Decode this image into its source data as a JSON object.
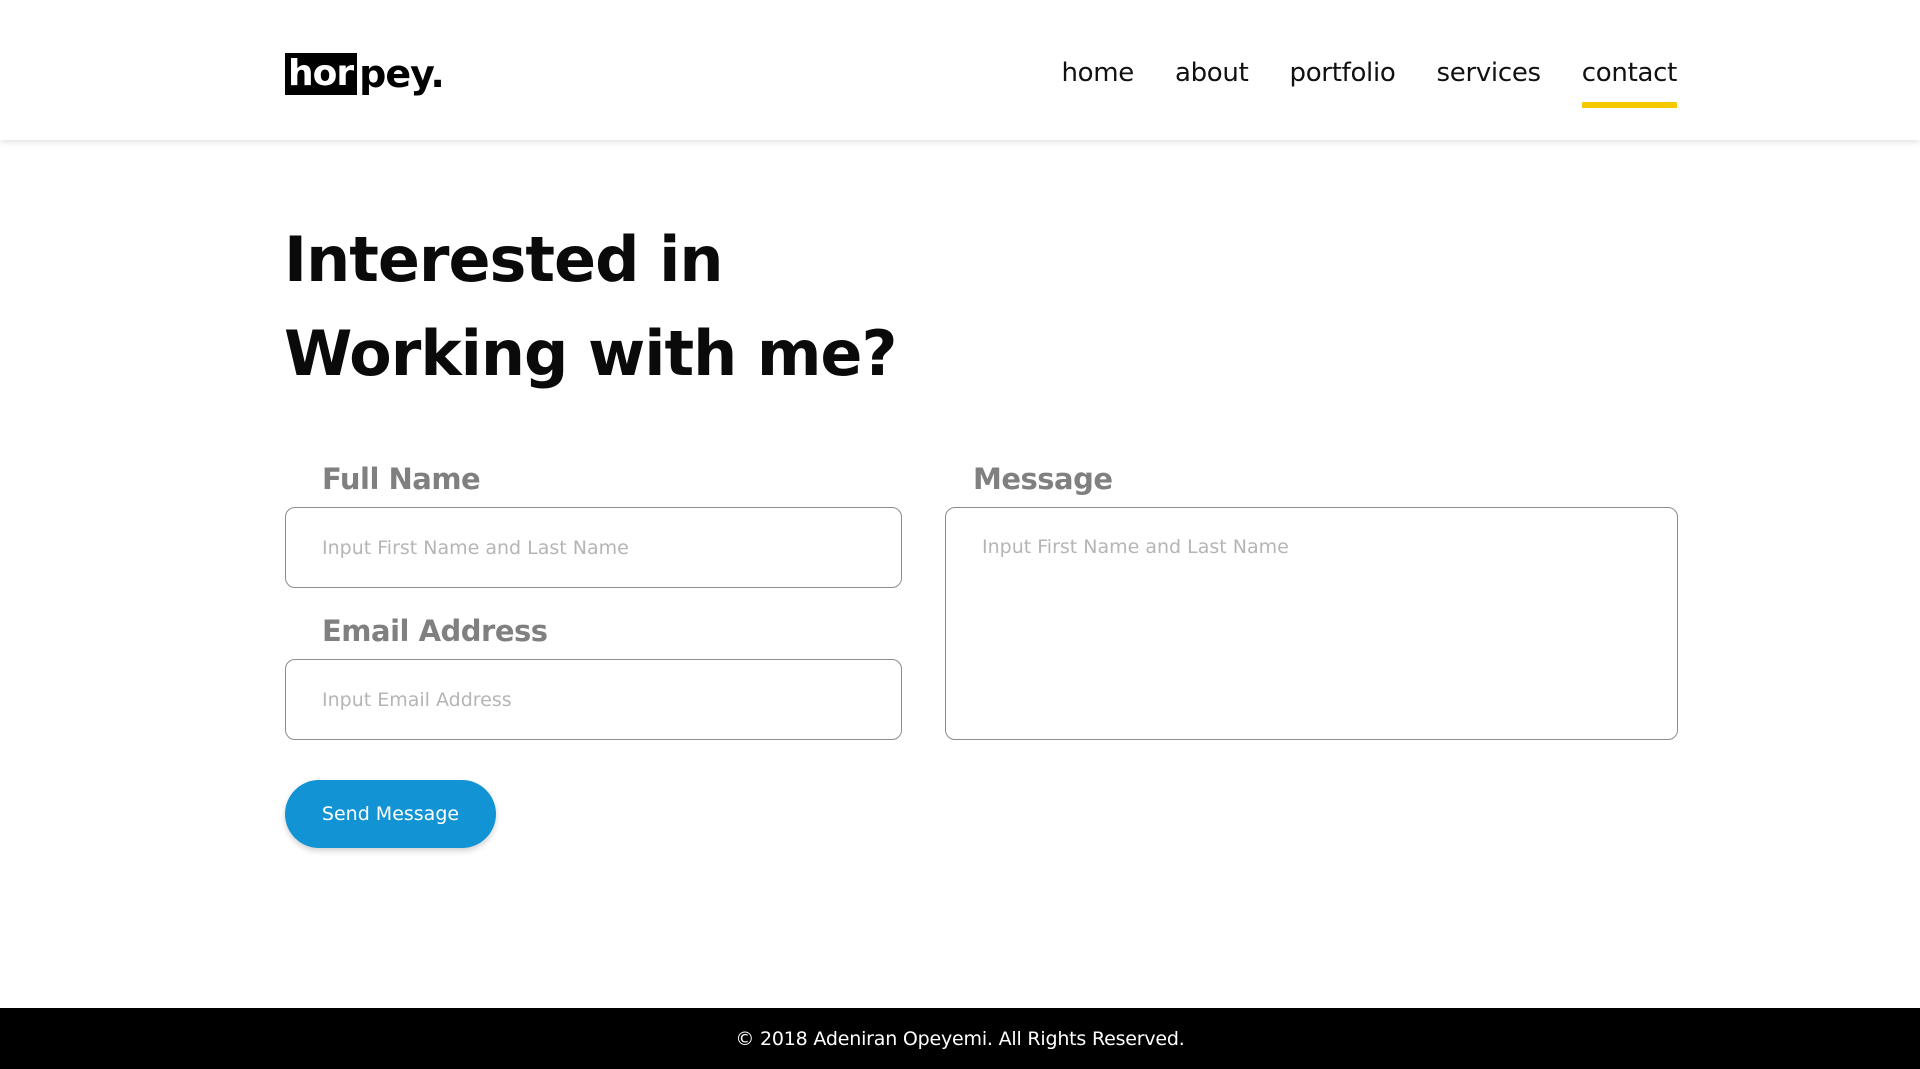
{
  "brand": {
    "logo_highlight": "hor",
    "logo_rest": "pey."
  },
  "nav": {
    "items": [
      {
        "label": "home",
        "active": false
      },
      {
        "label": "about",
        "active": false
      },
      {
        "label": "portfolio",
        "active": false
      },
      {
        "label": "services",
        "active": false
      },
      {
        "label": "contact",
        "active": true
      }
    ]
  },
  "hero": {
    "line1": "Interested in",
    "line2": "Working with me?"
  },
  "form": {
    "full_name_label": "Full Name",
    "full_name_placeholder": "Input First Name and Last Name",
    "email_label": "Email Address",
    "email_placeholder": "Input Email Address",
    "message_label": "Message",
    "message_placeholder": "Input First Name and Last Name",
    "submit_label": "Send Message"
  },
  "footer": {
    "copyright": "© 2018 Adeniran Opeyemi. All Rights Reserved."
  },
  "colors": {
    "accent_underline": "#f5c800",
    "button": "#1193d4",
    "footer_bg": "#000000"
  }
}
